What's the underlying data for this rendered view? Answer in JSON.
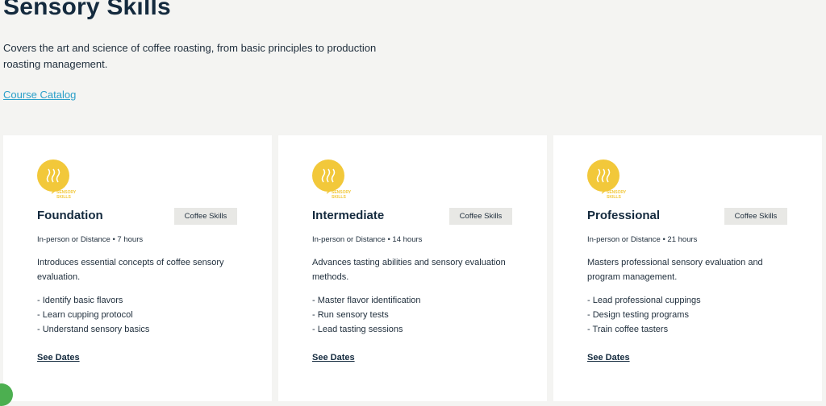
{
  "header": {
    "title": "Sensory Skills",
    "description": "Covers the art and science of coffee roasting, from basic principles to production roasting management.",
    "catalog_link": "Course Catalog"
  },
  "colors": {
    "accent_yellow": "#f2c83a",
    "link_blue": "#2a9fc9",
    "navy": "#142a3e"
  },
  "cards": [
    {
      "logo_text": "SENSORY SKILLS",
      "level": "Foundation",
      "tag": "Coffee Skills",
      "meta": "In-person or Distance • 7 hours",
      "summary": "Introduces essential concepts of coffee sensory evaluation.",
      "bullets": [
        "- Identify basic flavors",
        "- Learn cupping protocol",
        "- Understand sensory basics"
      ],
      "cta": "See Dates"
    },
    {
      "logo_text": "SENSORY SKILLS",
      "level": "Intermediate",
      "tag": "Coffee Skills",
      "meta": "In-person or Distance • 14 hours",
      "summary": "Advances tasting abilities and sensory evaluation methods.",
      "bullets": [
        "- Master flavor identification",
        "- Run sensory tests",
        "- Lead tasting sessions"
      ],
      "cta": "See Dates"
    },
    {
      "logo_text": "SENSORY SKILLS",
      "level": "Professional",
      "tag": "Coffee Skills",
      "meta": "In-person or Distance • 21 hours",
      "summary": "Masters professional sensory evaluation and program management.",
      "bullets": [
        "- Lead professional cuppings",
        "- Design testing programs",
        "- Train coffee tasters"
      ],
      "cta": "See Dates"
    }
  ]
}
